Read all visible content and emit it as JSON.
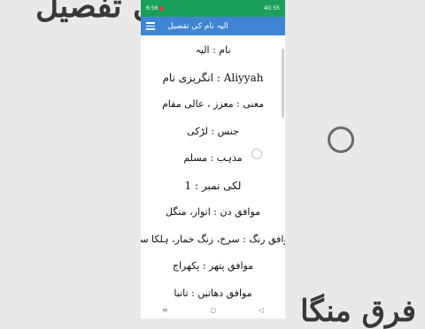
{
  "background": {
    "top_text": "کی تفصیل",
    "bottom_text": "فرق منگا"
  },
  "status_bar": {
    "time": "6:56",
    "signal": "4G",
    "battery": "55"
  },
  "app_bar": {
    "title": "الیہ نام کی تفصیل"
  },
  "details": [
    "نام : الیہ",
    "انگریزی نام : Aliyyah",
    "معنی : معزز ، عالی مقام",
    "جنس : لڑکی",
    "مذہب : مسلم",
    "لکی نمبر : 1",
    "موافق دن : اتوار، منگل",
    "موافق رنگ : سرخ، زنگ خمار، ہلکا سبز",
    "موافق پتھر : پکھراج",
    "موافق دھاتیں : تانبا"
  ],
  "nav": {
    "menu_glyph": "≡",
    "home_glyph": "○",
    "back_glyph": "◁"
  },
  "colors": {
    "status_bar": "#1ba05c",
    "app_bar": "#3f85d4"
  }
}
